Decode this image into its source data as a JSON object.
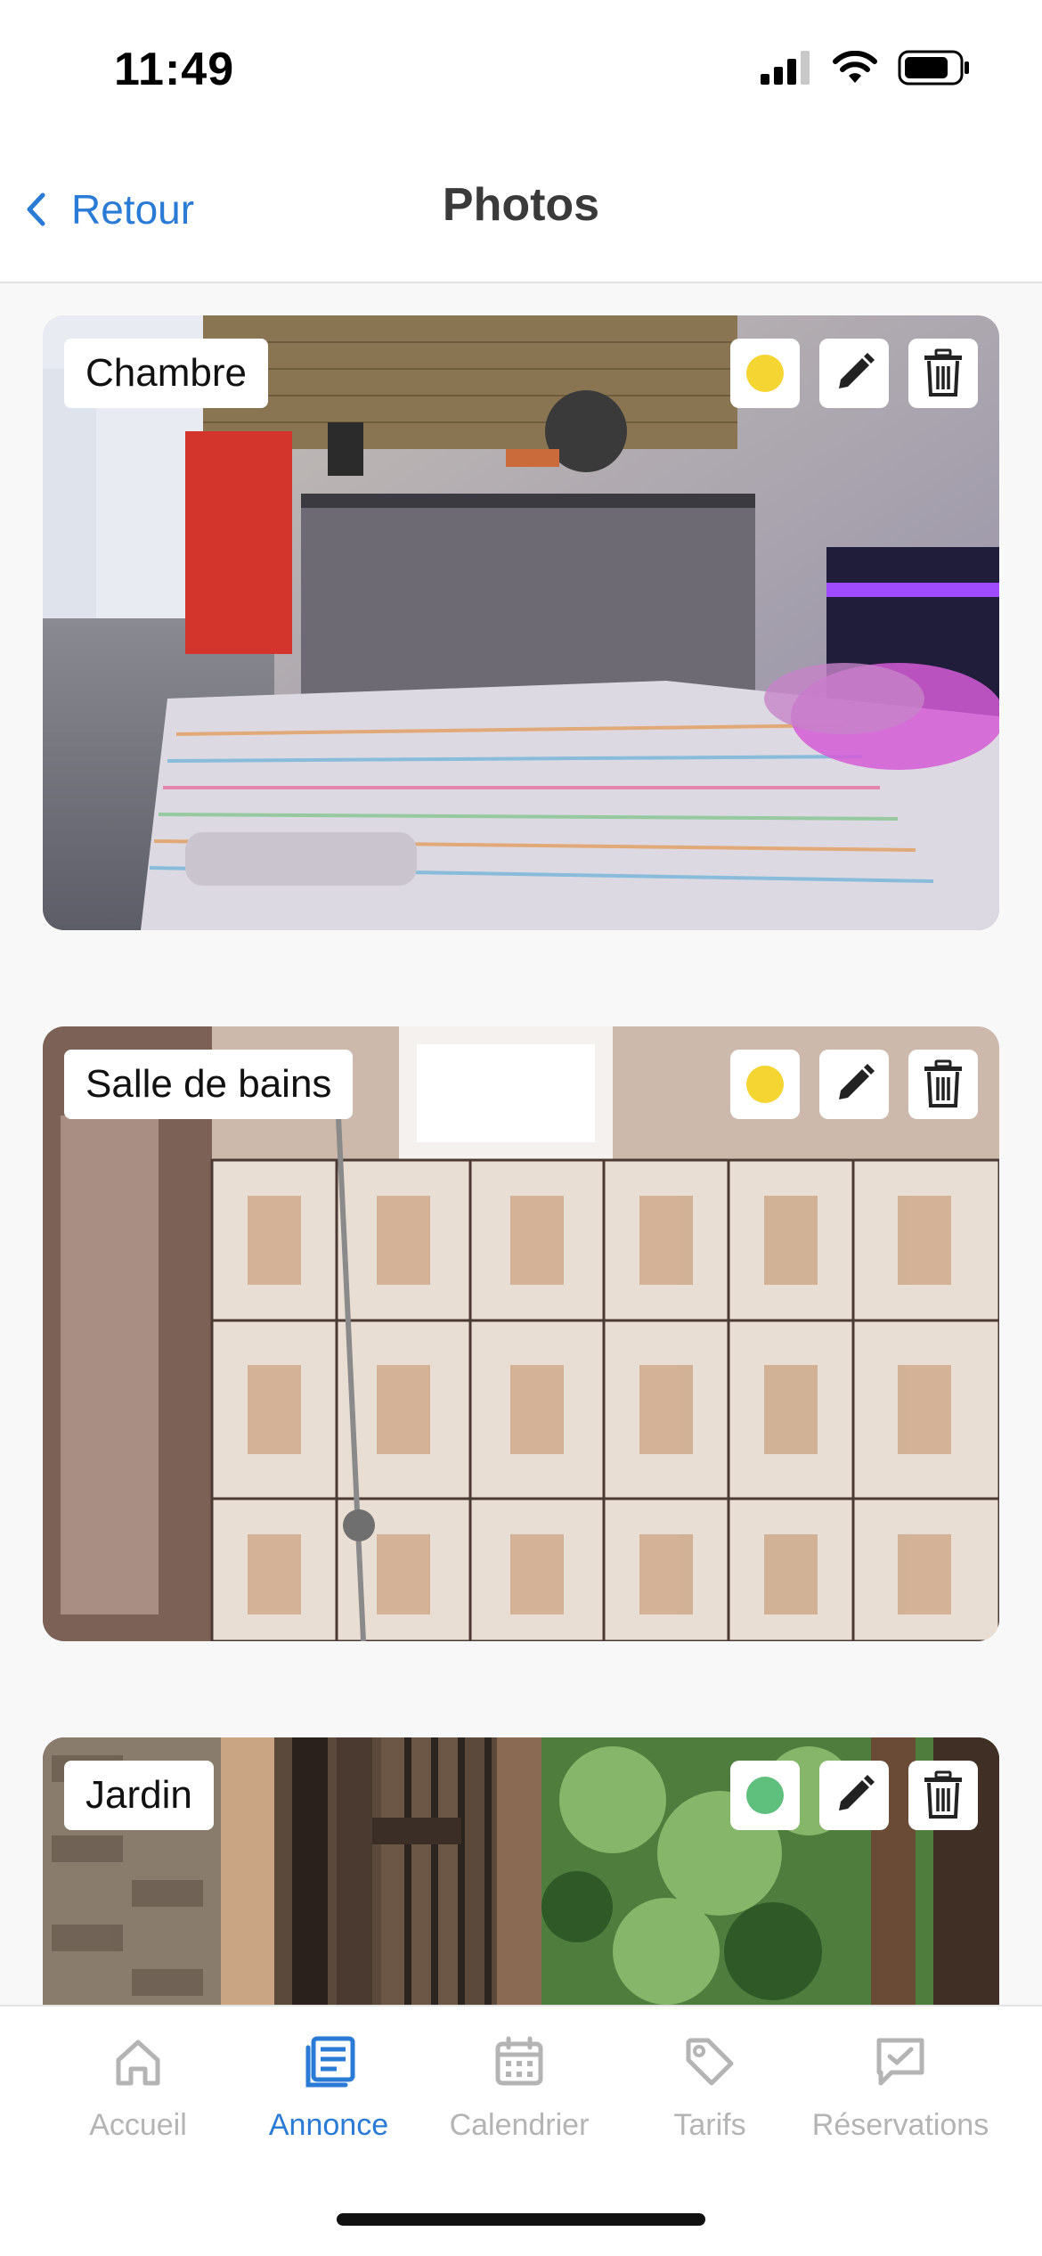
{
  "status_bar": {
    "time": "11:49"
  },
  "header": {
    "back_label": "Retour",
    "title": "Photos"
  },
  "photos": [
    {
      "label": "Chambre",
      "status_color": "#f5d531",
      "status_icon": "status-dot-icon",
      "edit_icon": "pencil-icon",
      "delete_icon": "trash-icon"
    },
    {
      "label": "Salle de bains",
      "status_color": "#f5d531",
      "status_icon": "status-dot-icon",
      "edit_icon": "pencil-icon",
      "delete_icon": "trash-icon"
    },
    {
      "label": "Jardin",
      "status_color": "#5fbf7d",
      "status_icon": "status-dot-icon",
      "edit_icon": "pencil-icon",
      "delete_icon": "trash-icon"
    }
  ],
  "tabs": [
    {
      "label": "Accueil",
      "icon": "home-icon",
      "active": false
    },
    {
      "label": "Annonce",
      "icon": "listing-icon",
      "active": true
    },
    {
      "label": "Calendrier",
      "icon": "calendar-icon",
      "active": false
    },
    {
      "label": "Tarifs",
      "icon": "tag-icon",
      "active": false
    },
    {
      "label": "Réservations",
      "icon": "reservations-icon",
      "active": false
    }
  ],
  "colors": {
    "accent": "#2a7bd5",
    "inactive": "#b4b4b4",
    "pending": "#f5d531",
    "validated": "#5fbf7d"
  }
}
